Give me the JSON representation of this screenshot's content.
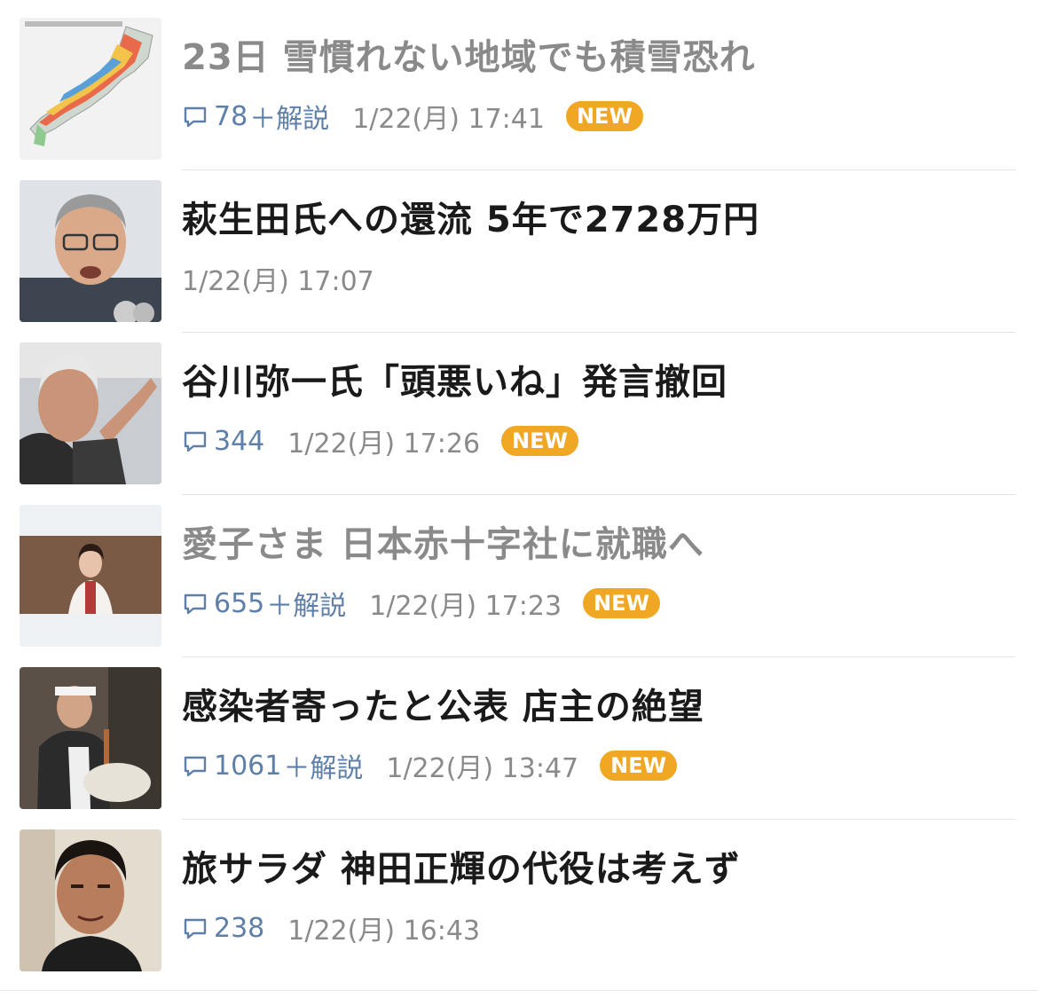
{
  "articles": [
    {
      "title": "23日 雪慣れない地域でも積雪恐れ",
      "read": true,
      "comments": "78",
      "kaisetsu": "＋解説",
      "time": "1/22(月) 17:41",
      "badge": "NEW",
      "thumb": "map"
    },
    {
      "title": "萩生田氏への還流 5年で2728万円",
      "read": false,
      "comments": "",
      "kaisetsu": "",
      "time": "1/22(月) 17:07",
      "badge": "",
      "thumb": "man-glasses"
    },
    {
      "title": "谷川弥一氏「頭悪いね」発言撤回",
      "read": false,
      "comments": "344",
      "kaisetsu": "",
      "time": "1/22(月) 17:26",
      "badge": "NEW",
      "thumb": "old-man"
    },
    {
      "title": "愛子さま 日本赤十字社に就職へ",
      "read": true,
      "comments": "655",
      "kaisetsu": "＋解説",
      "time": "1/22(月) 17:23",
      "badge": "NEW",
      "thumb": "princess"
    },
    {
      "title": "感染者寄ったと公表 店主の絶望",
      "read": false,
      "comments": "1061",
      "kaisetsu": "＋解説",
      "time": "1/22(月) 13:47",
      "badge": "NEW",
      "thumb": "chef"
    },
    {
      "title": "旅サラダ 神田正輝の代役は考えず",
      "read": false,
      "comments": "238",
      "kaisetsu": "",
      "time": "1/22(月) 16:43",
      "badge": "",
      "thumb": "actor"
    }
  ],
  "colors": {
    "comment_blue": "#5e7fa8",
    "badge_orange": "#f0a723",
    "read_gray": "#8a8a8a",
    "title_black": "#1a1a1a"
  },
  "icons": {
    "comment": "speech-bubble-icon"
  }
}
